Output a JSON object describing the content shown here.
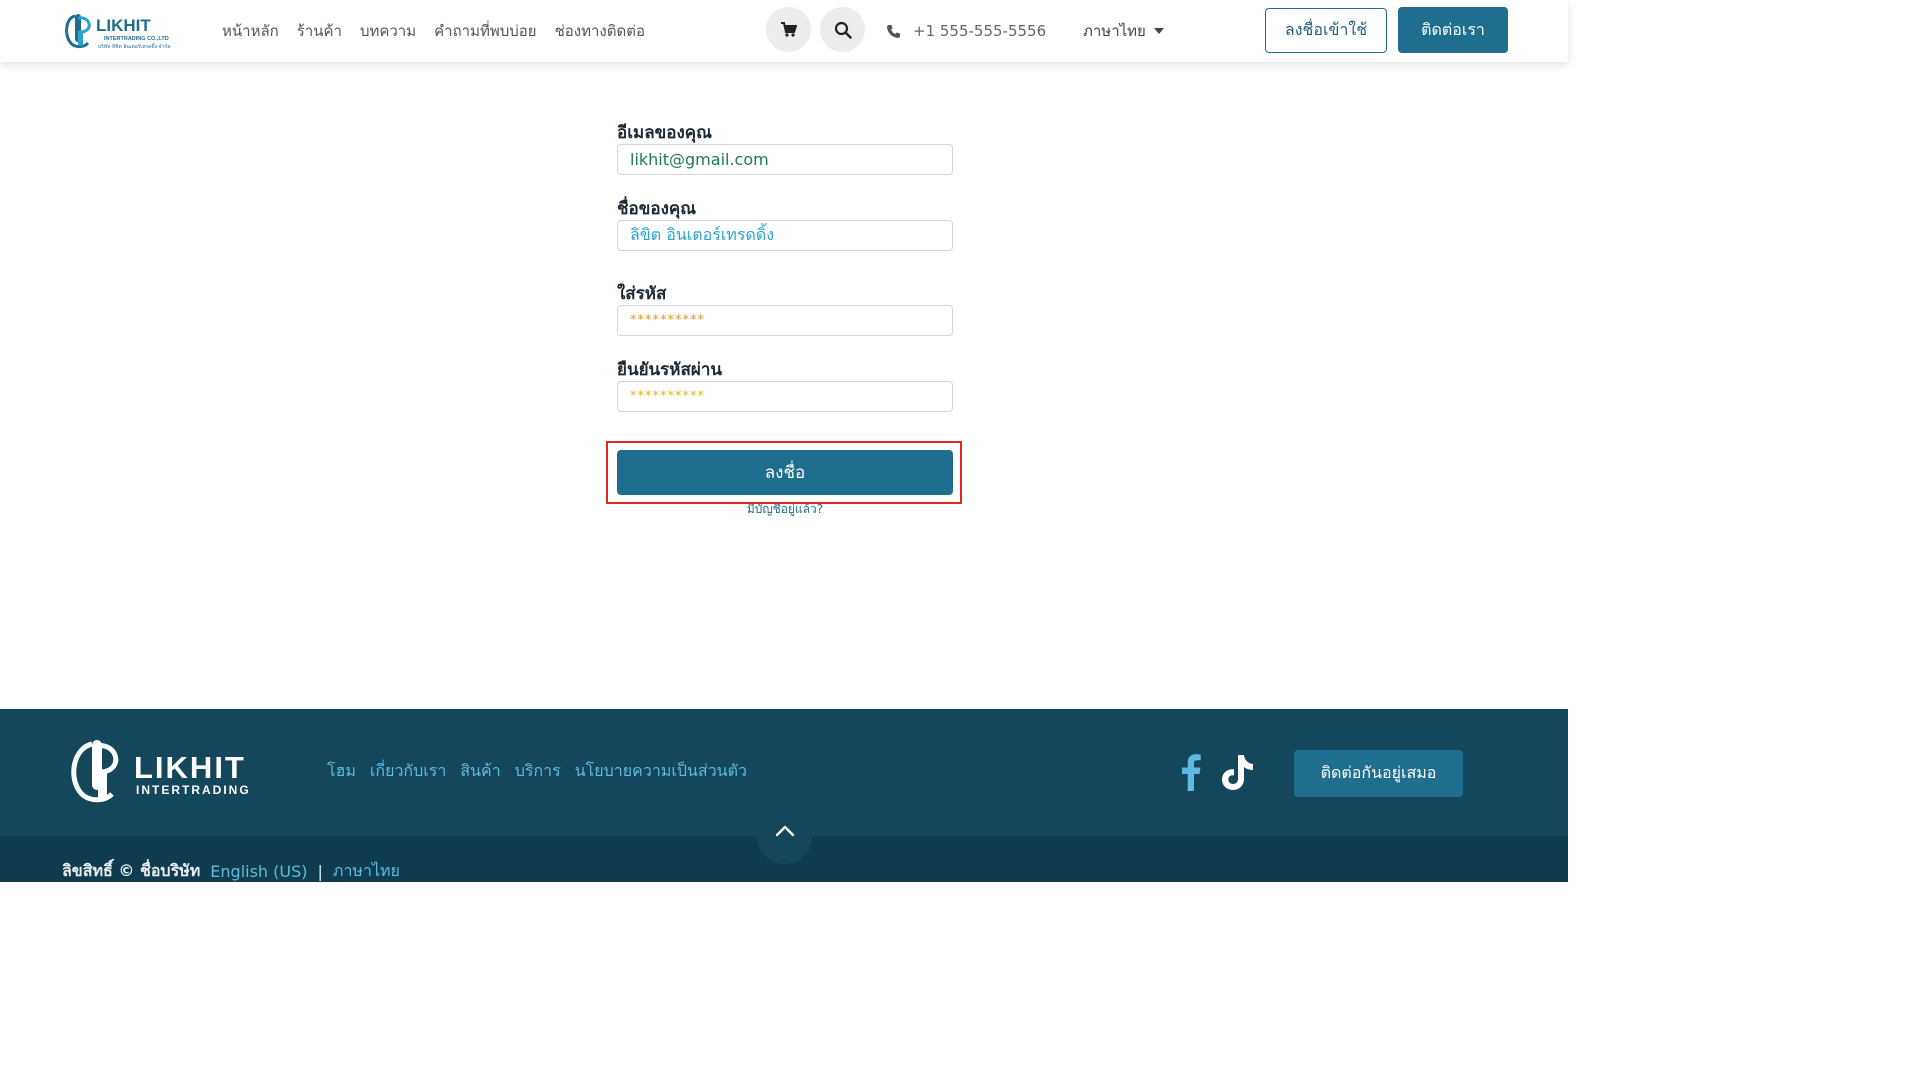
{
  "header": {
    "logo_name": "LIKHIT",
    "logo_sub": "INTERTRADING CO.,LTD",
    "logo_thai": "บริษัท ลิขิต อินเตอร์เทรดดิ้ง จำกัด",
    "nav": [
      "หน้าหลัก",
      "ร้านค้า",
      "บทความ",
      "คำถามที่พบบ่อย",
      "ช่องทางติดต่อ"
    ],
    "phone": "+1 555-555-5556",
    "language": "ภาษาไทย",
    "signin_label": "ลงชื่อเข้าใช้",
    "contact_label": "ติดต่อเรา"
  },
  "form": {
    "email_label": "อีเมลของคุณ",
    "email_value": "likhit@gmail.com",
    "name_label": "ชื่อของคุณ",
    "name_value": "ลิขิต อินเตอร์เทรดดิ้ง",
    "password_label": "ใส่รหัส",
    "password_value": "**********",
    "confirm_label": "ยืนยันรหัสผ่าน",
    "confirm_value": "**********",
    "submit_label": "ลงชื่อ",
    "have_account": "มีบัญชีอยู่แล้ว?"
  },
  "footer": {
    "logo_name": "LIKHIT",
    "logo_sub": "INTERTRADING",
    "links": [
      "โฮม",
      "เกี่ยวกับเรา",
      "สินค้า",
      "บริการ",
      "นโยบายความเป็นส่วนตัว"
    ],
    "stay_label": "ติดต่อกันอยู่เสมอ",
    "copyright": "ลิขสิทธิ์ © ชื่อบริษัท",
    "lang_en": "English (US)",
    "separator": "|",
    "lang_th": "ภาษาไทย"
  },
  "colors": {
    "primary": "#1f6e8f",
    "footer_bg": "#14475c",
    "footer_link": "#5fb9e0",
    "highlight": "#e32626"
  },
  "icons": [
    "cart-icon",
    "search-icon",
    "phone-icon",
    "caret-down-icon",
    "facebook-icon",
    "tiktok-icon",
    "chevron-up-icon"
  ]
}
